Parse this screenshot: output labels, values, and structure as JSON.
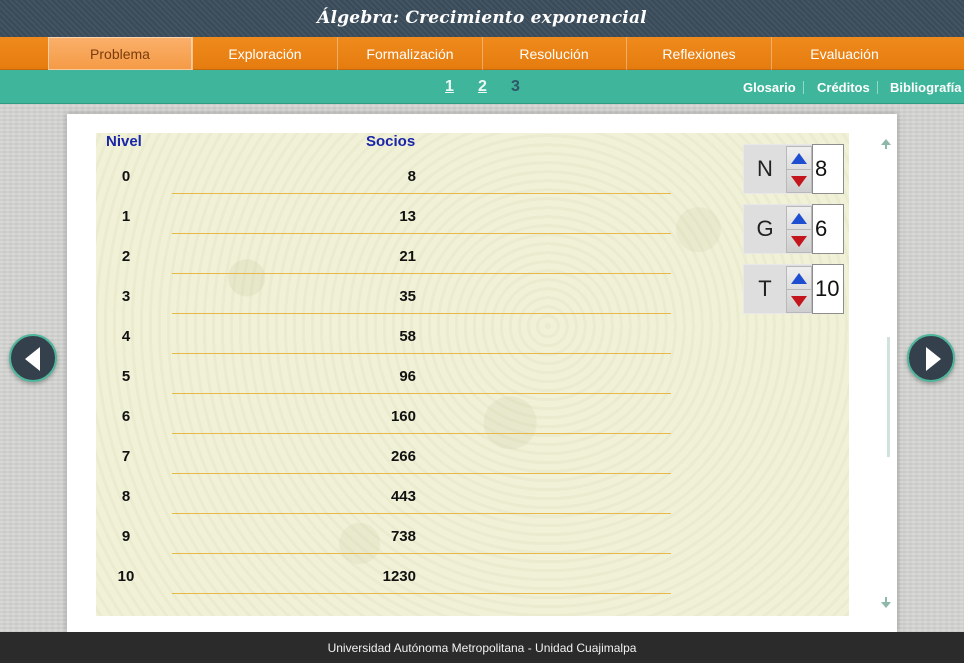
{
  "header": {
    "title": "Álgebra: Crecimiento exponencial"
  },
  "nav": {
    "items": [
      {
        "label": "Problema",
        "active": true
      },
      {
        "label": "Exploración"
      },
      {
        "label": "Formalización"
      },
      {
        "label": "Resolución"
      },
      {
        "label": "Reflexiones"
      },
      {
        "label": "Evaluación"
      }
    ]
  },
  "subnav": {
    "pages": [
      "1",
      "2",
      "3"
    ],
    "current_page": "3",
    "links": [
      "Glosario",
      "Créditos",
      "Bibliografía"
    ]
  },
  "table": {
    "headers": {
      "level": "Nivel",
      "members": "Socios"
    },
    "rows": [
      {
        "level": "0",
        "members": "8"
      },
      {
        "level": "1",
        "members": "13"
      },
      {
        "level": "2",
        "members": "21"
      },
      {
        "level": "3",
        "members": "35"
      },
      {
        "level": "4",
        "members": "58"
      },
      {
        "level": "5",
        "members": "96"
      },
      {
        "level": "6",
        "members": "160"
      },
      {
        "level": "7",
        "members": "266"
      },
      {
        "level": "8",
        "members": "443"
      },
      {
        "level": "9",
        "members": "738"
      },
      {
        "level": "10",
        "members": "1230"
      }
    ]
  },
  "spinners": [
    {
      "label": "N",
      "value": "8"
    },
    {
      "label": "G",
      "value": "6"
    },
    {
      "label": "T",
      "value": "10"
    }
  ],
  "footer": {
    "text": "Universidad Autónoma Metropolitana - Unidad Cuajimalpa"
  },
  "colors": {
    "header_bg": "#3b4d5c",
    "nav_orange": "#e57c0f",
    "subnav_teal": "#3fb69b",
    "heading_blue": "#1a25a8",
    "row_line": "#e8b84a",
    "spin_up": "#1e4fd0",
    "spin_down": "#c4141c"
  }
}
